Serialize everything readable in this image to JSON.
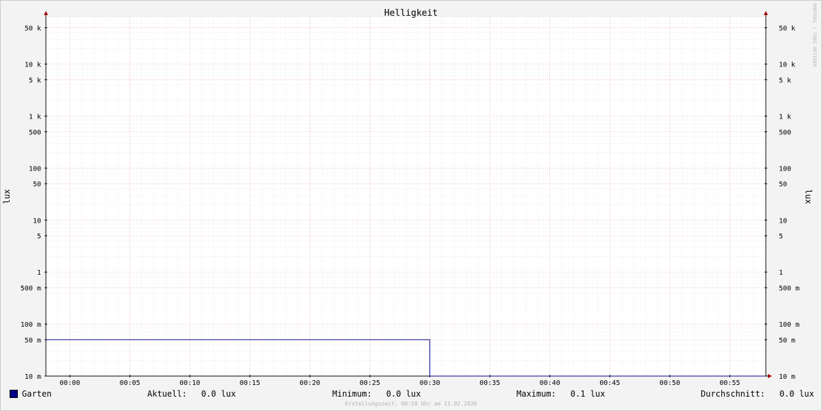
{
  "colors": {
    "background": "#f3f3f3",
    "canvas": "#ffffff",
    "minor_grid": "#dcdcdc",
    "major_grid": "#f0a0a0",
    "axis": "#000000",
    "arrow": "#aa0000",
    "series": "#000088",
    "watermark": "#b8b8b8"
  },
  "chart_data": {
    "type": "line",
    "title": "Helligkeit",
    "ylabel": "lux",
    "ylabel_right": "lux",
    "yscale": "log",
    "ylim": [
      0.01,
      80000
    ],
    "xlim": [
      "23:58",
      "00:58"
    ],
    "y_ticks": [
      {
        "value": 50000,
        "label": "50 k"
      },
      {
        "value": 10000,
        "label": "10 k"
      },
      {
        "value": 5000,
        "label": "5 k"
      },
      {
        "value": 1000,
        "label": "1 k"
      },
      {
        "value": 500,
        "label": "500"
      },
      {
        "value": 100,
        "label": "100"
      },
      {
        "value": 50,
        "label": "50"
      },
      {
        "value": 10,
        "label": "10"
      },
      {
        "value": 5,
        "label": "5"
      },
      {
        "value": 1,
        "label": "1"
      },
      {
        "value": 0.5,
        "label": "500 m"
      },
      {
        "value": 0.1,
        "label": "100 m"
      },
      {
        "value": 0.05,
        "label": "50 m"
      },
      {
        "value": 0.01,
        "label": "10 m"
      }
    ],
    "x_ticks": [
      "00:00",
      "00:05",
      "00:10",
      "00:15",
      "00:20",
      "00:25",
      "00:30",
      "00:35",
      "00:40",
      "00:45",
      "00:50",
      "00:55"
    ],
    "grid": true,
    "legend_position": "bottom",
    "series": [
      {
        "name": "Garten",
        "color": "#000088",
        "points": [
          {
            "x": "23:58",
            "y": 0.05
          },
          {
            "x": "00:30",
            "y": 0.05
          },
          {
            "x": "00:30",
            "y": 0.01
          },
          {
            "x": "00:58",
            "y": 0.01
          }
        ]
      }
    ],
    "watermark": "RRDTOOL / TOBI OETIKER"
  },
  "legend": {
    "series_name": "Garten",
    "current_label": "Aktuell:",
    "current_value": "0.0 lux",
    "minimum_label": "Minimum:",
    "minimum_value": "0.0 lux",
    "maximum_label": "Maximum:",
    "maximum_value": "0.1 lux",
    "average_label": "Durchschnitt:",
    "average_value": "0.0 lux"
  },
  "footer": "Erstellungszeit: 00:58 Uhr am 11.02.2026"
}
